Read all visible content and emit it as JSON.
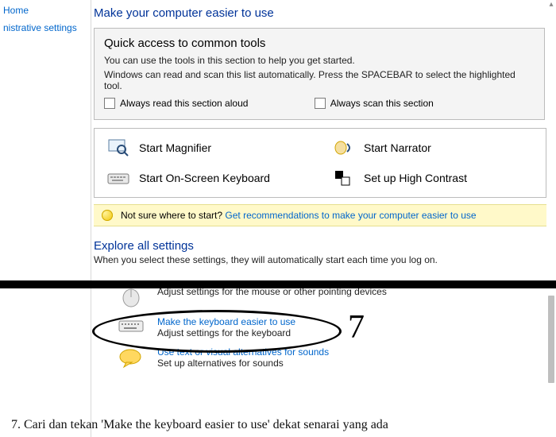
{
  "sidebar": {
    "home": "Home",
    "admin": "nistrative settings"
  },
  "title": "Make your computer easier to use",
  "quick": {
    "heading": "Quick access to common tools",
    "line1": "You can use the tools in this section to help you get started.",
    "line2": "Windows can read and scan this list automatically.  Press the SPACEBAR to select the highlighted tool.",
    "chkRead": "Always read this section aloud",
    "chkScan": "Always scan this section"
  },
  "tools": {
    "magnifier": "Start Magnifier",
    "narrator": "Start Narrator",
    "osk": "Start On-Screen Keyboard",
    "contrast": "Set up High Contrast"
  },
  "tip": {
    "lead": "Not sure where to start?",
    "link": "Get recommendations to make your computer easier to use"
  },
  "explore": {
    "heading": "Explore all settings",
    "sub": "When you select these settings, they will automatically start each time you log on."
  },
  "settings": {
    "mouse": {
      "desc": "Adjust settings for the mouse or other pointing devices"
    },
    "keyboard": {
      "title": "Make the keyboard easier to use",
      "desc": "Adjust settings for the keyboard"
    },
    "sounds": {
      "title": "Use text or visual alternatives for sounds",
      "desc": "Set up alternatives for sounds"
    }
  },
  "annotation": {
    "number": "7",
    "caption": "7. Cari dan tekan 'Make the keyboard easier to use' dekat senarai yang ada"
  }
}
